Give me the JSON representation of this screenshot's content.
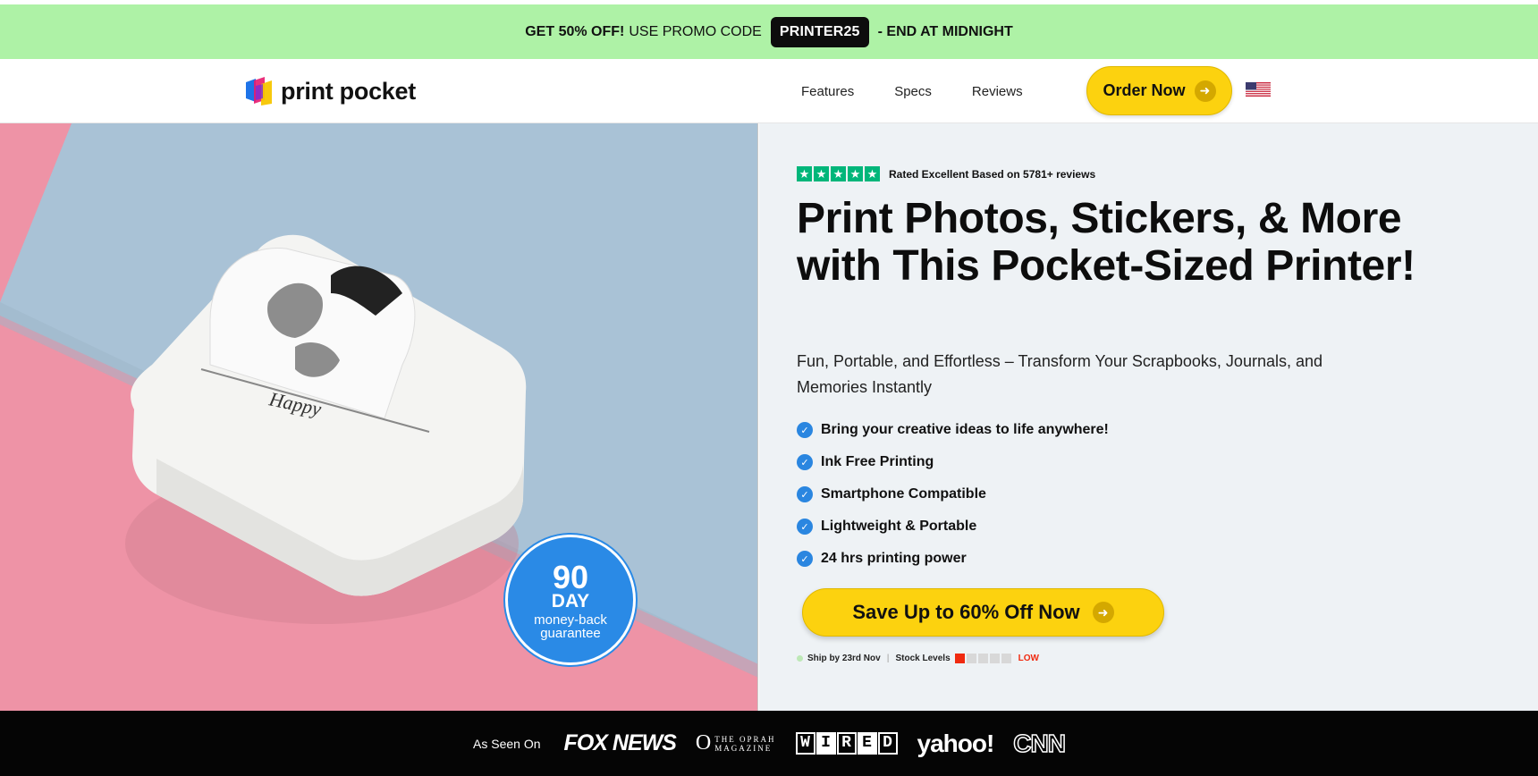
{
  "promo": {
    "lead": "GET 50% OFF!",
    "middle": "USE PROMO CODE",
    "code": "PRINTER25",
    "tail": "- END AT MIDNIGHT"
  },
  "header": {
    "logo_text": "print pocket",
    "nav": [
      "Features",
      "Specs",
      "Reviews"
    ],
    "order_label": "Order Now",
    "flag": "us-flag-icon"
  },
  "hero": {
    "badge_number": "90",
    "badge_unit": "DAY",
    "badge_line1": "money-back",
    "badge_line2": "guarantee"
  },
  "panel": {
    "rating_text": "Rated Excellent Based on 5781+ reviews",
    "stars": 5,
    "headline": "Print Photos, Stickers, & More with This Pocket-Sized Printer!",
    "subheadline": "Fun, Portable, and Effortless – Transform Your Scrapbooks, Journals, and Memories Instantly",
    "features": [
      "Bring your creative ideas to life anywhere!",
      "Ink Free Printing",
      "Smartphone Compatible",
      "Lightweight & Portable",
      "24 hrs printing power"
    ],
    "cta_label": "Save Up to 60% Off Now",
    "ship_text": "Ship by 23rd Nov",
    "stock_label": "Stock Levels",
    "stock_level": "LOW",
    "stock_filled": 1,
    "stock_total": 5
  },
  "seen_on": {
    "label": "As Seen On",
    "outlets": {
      "fox": "FOX NEWS",
      "oprah_o": "O",
      "oprah_line1": "THE OPRAH",
      "oprah_line2": "MAGAZINE",
      "wired": [
        "W",
        "I",
        "R",
        "E",
        "D"
      ],
      "yahoo": "yahoo!",
      "cnn": "CNN"
    }
  },
  "colors": {
    "promo_bg": "#aef2a6",
    "accent_yellow": "#fcd20f",
    "check_blue": "#2a86e0",
    "trustpilot_green": "#00b67a",
    "stock_red": "#f02a10"
  }
}
